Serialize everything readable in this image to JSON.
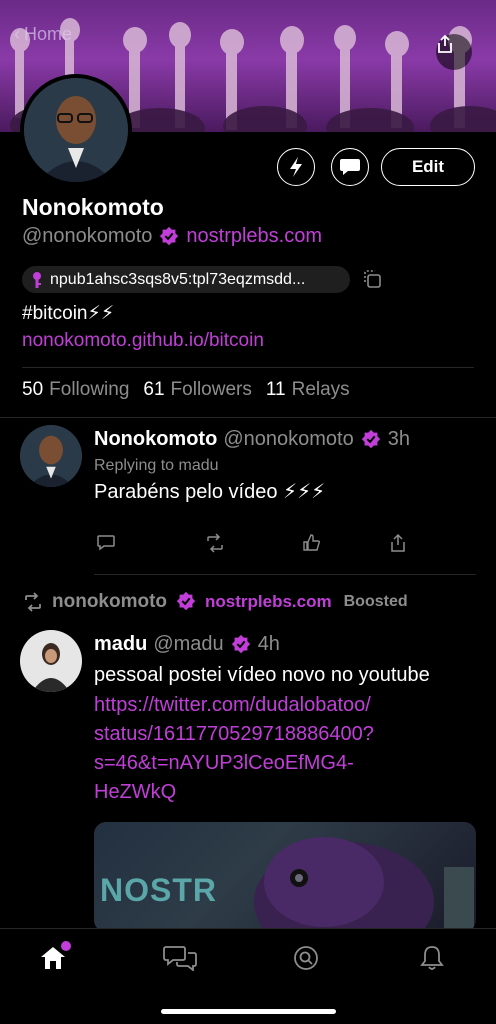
{
  "header": {
    "back_label": "Home"
  },
  "profile": {
    "display_name": "Nonokomoto",
    "handle": "@nonokomoto",
    "nip05": "nostrplebs.com",
    "npub": "npub1ahsc3sqs8v5:tpl73eqzmsdd...",
    "bio": "#bitcoin⚡⚡",
    "website": "nonokomoto.github.io/bitcoin",
    "edit_label": "Edit"
  },
  "stats": {
    "following_count": "50",
    "following_label": "Following",
    "followers_count": "61",
    "followers_label": "Followers",
    "relays_count": "11",
    "relays_label": "Relays"
  },
  "posts": [
    {
      "name": "Nonokomoto",
      "handle": "@nonokomoto",
      "time": "3h",
      "replying": "Replying to madu",
      "text": "Parabéns pelo vídeo ⚡⚡⚡"
    },
    {
      "booster_name": "nonokomoto",
      "booster_nip05": "nostrplebs.com",
      "boost_status": "Boosted",
      "name": "madu",
      "handle": "@madu",
      "time": "4h",
      "text": "pessoal postei vídeo novo no youtube",
      "link_lines": [
        "https://twitter.com/dudalobatoo/",
        "status/1611770529718886400?",
        "s=46&t=nAYUP3lCeoEfMG4-",
        "HeZWkQ"
      ],
      "media_text": "NOSTR"
    }
  ],
  "tabs": [
    {
      "name": "home-icon"
    },
    {
      "name": "messages-icon"
    },
    {
      "name": "search-icon"
    },
    {
      "name": "notifications-icon"
    }
  ],
  "colors": {
    "accent": "#c13fd8",
    "muted": "#8d8d8d",
    "background": "#000000"
  }
}
